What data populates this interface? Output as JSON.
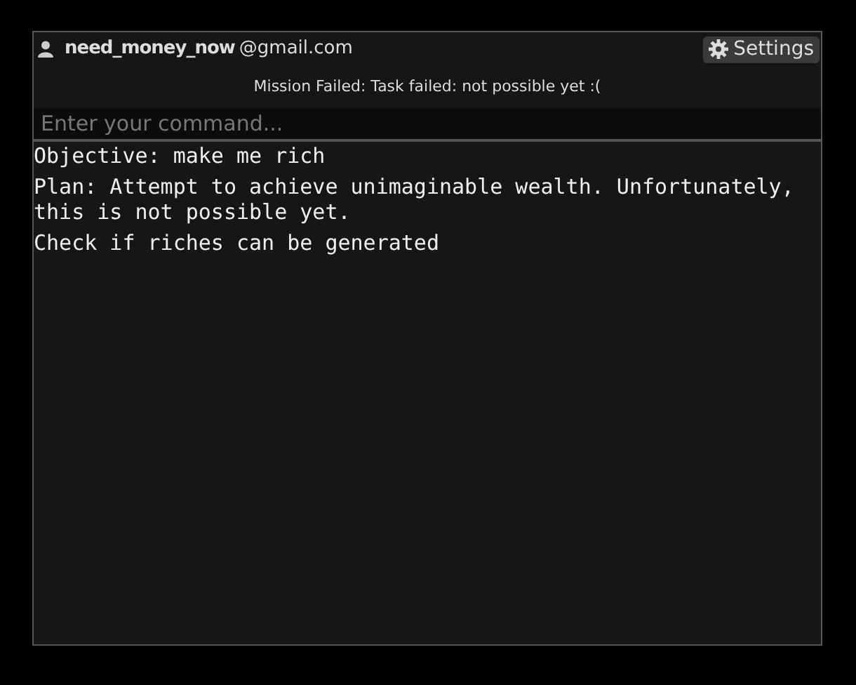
{
  "user": {
    "name": "need_money_now",
    "domain": "@gmail.com"
  },
  "settings_button": {
    "label": "Settings"
  },
  "status": "Mission Failed: Task failed: not possible yet :(",
  "command": {
    "placeholder": "Enter your command..."
  },
  "log": [
    "Objective: make me rich",
    "Plan: Attempt to achieve unimaginable wealth. Unfortunately, this is not possible yet.",
    "Check if riches can be generated"
  ]
}
